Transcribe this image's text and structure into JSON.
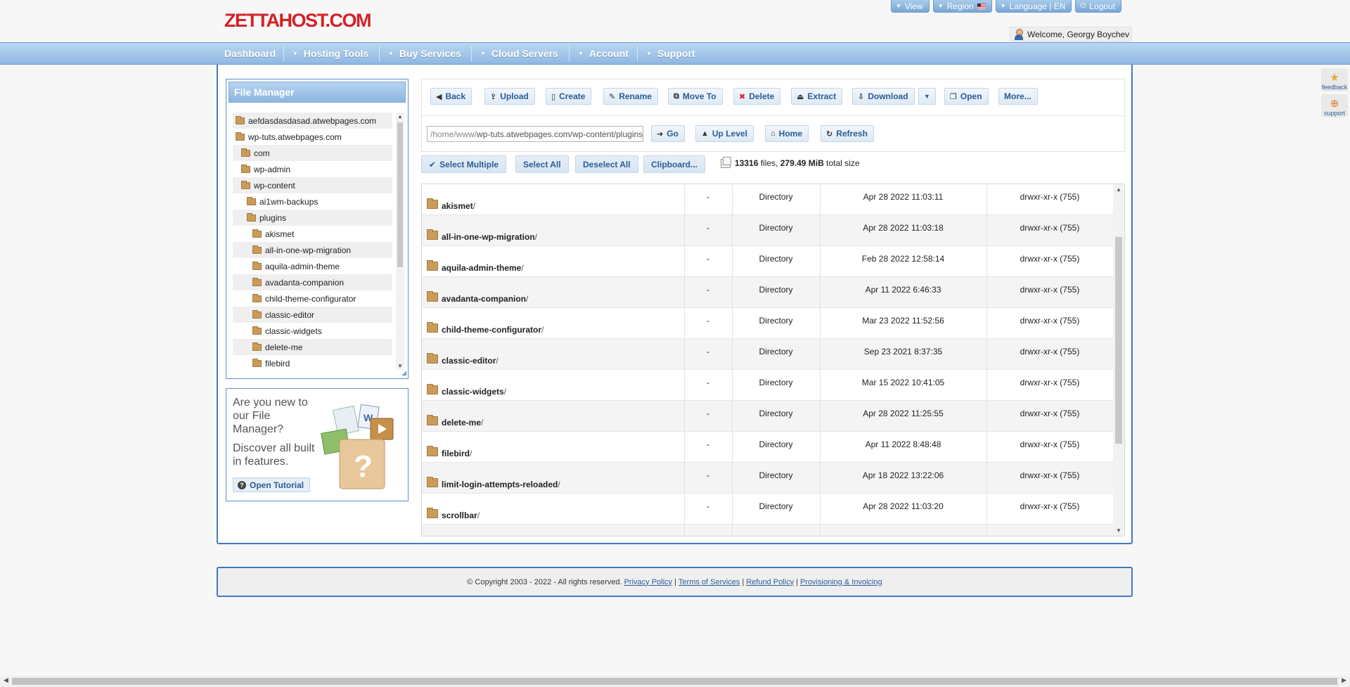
{
  "header": {
    "logo": "ZETTAHOST.COM",
    "top_buttons": [
      {
        "label": "View",
        "icon": "caret-down-icon"
      },
      {
        "label": "Region",
        "icon": "caret-down-icon",
        "flag": "us-flag-icon"
      },
      {
        "label": "Language | EN",
        "icon": "caret-down-icon"
      },
      {
        "label": "Logout",
        "icon": "power-icon"
      }
    ],
    "welcome": "Welcome, Georgy Boychev"
  },
  "nav": {
    "items": [
      "Dashboard",
      "Hosting Tools",
      "Buy Services",
      "Cloud Servers",
      "Account",
      "Support"
    ]
  },
  "file_manager": {
    "title": "File Manager",
    "tree": [
      "aefdasdasdasad.atwebpages.com",
      "wp-tuts.atwebpages.com",
      "com",
      "wp-admin",
      "wp-content",
      "ai1wm-backups",
      "plugins",
      "akismet",
      "all-in-one-wp-migration",
      "aquila-admin-theme",
      "avadanta-companion",
      "child-theme-configurator",
      "classic-editor",
      "classic-widgets",
      "delete-me",
      "filebird"
    ]
  },
  "tutorial": {
    "question": "Are you new to our File Manager?",
    "discover": "Discover all built in features.",
    "button": "Open Tutorial"
  },
  "toolbar": {
    "buttons": [
      "Back",
      "Upload",
      "Create",
      "Rename",
      "Move To",
      "Delete",
      "Extract",
      "Download",
      "Open",
      "More..."
    ],
    "path_prefix": "/home/www/",
    "path_rest": "wp-tuts.atwebpages.com/wp-content/plugins",
    "nav_buttons": [
      "Go",
      "Up Level",
      "Home",
      "Refresh"
    ]
  },
  "selection": {
    "buttons": [
      "Select Multiple",
      "Select All",
      "Deselect All",
      "Clipboard..."
    ],
    "file_count": "13316",
    "files_word": "files,",
    "total_size": "279.49 MiB",
    "size_word": "total size"
  },
  "files": [
    {
      "name": "akismet",
      "size": "-",
      "type": "Directory",
      "date": "Apr 28 2022 11:03:11",
      "perm": "drwxr-xr-x (755)"
    },
    {
      "name": "all-in-one-wp-migration",
      "size": "-",
      "type": "Directory",
      "date": "Apr 28 2022 11:03:18",
      "perm": "drwxr-xr-x (755)"
    },
    {
      "name": "aquila-admin-theme",
      "size": "-",
      "type": "Directory",
      "date": "Feb 28 2022 12:58:14",
      "perm": "drwxr-xr-x (755)"
    },
    {
      "name": "avadanta-companion",
      "size": "-",
      "type": "Directory",
      "date": "Apr 11 2022 6:46:33",
      "perm": "drwxr-xr-x (755)"
    },
    {
      "name": "child-theme-configurator",
      "size": "-",
      "type": "Directory",
      "date": "Mar 23 2022 11:52:56",
      "perm": "drwxr-xr-x (755)"
    },
    {
      "name": "classic-editor",
      "size": "-",
      "type": "Directory",
      "date": "Sep 23 2021 8:37:35",
      "perm": "drwxr-xr-x (755)"
    },
    {
      "name": "classic-widgets",
      "size": "-",
      "type": "Directory",
      "date": "Mar 15 2022 10:41:05",
      "perm": "drwxr-xr-x (755)"
    },
    {
      "name": "delete-me",
      "size": "-",
      "type": "Directory",
      "date": "Apr 28 2022 11:25:55",
      "perm": "drwxr-xr-x (755)"
    },
    {
      "name": "filebird",
      "size": "-",
      "type": "Directory",
      "date": "Apr 11 2022 8:48:48",
      "perm": "drwxr-xr-x (755)"
    },
    {
      "name": "limit-login-attempts-reloaded",
      "size": "-",
      "type": "Directory",
      "date": "Apr 18 2022 13:22:06",
      "perm": "drwxr-xr-x (755)"
    },
    {
      "name": "scrollbar",
      "size": "-",
      "type": "Directory",
      "date": "Apr 28 2022 11:03:20",
      "perm": "drwxr-xr-x (755)"
    }
  ],
  "footer": {
    "copyright": "© Copyright 2003 - 2022 - All rights reserved.",
    "links": [
      "Privacy Policy",
      "Terms of Services",
      "Refund Policy",
      "Provisioning & Invoicing"
    ]
  },
  "side_widgets": [
    "feedback",
    "support"
  ],
  "colors": {
    "brand": "#d32127",
    "nav": "#8fb9e2",
    "panel_border": "#3f7bbf",
    "link": "#2a5d98"
  }
}
